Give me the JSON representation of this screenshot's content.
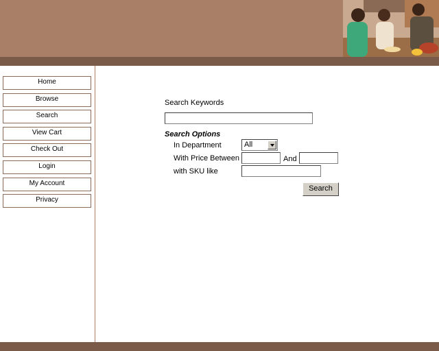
{
  "nav": {
    "items": [
      "Home",
      "Browse",
      "Search",
      "View Cart",
      "Check Out",
      "Login",
      "My Account",
      "Privacy"
    ]
  },
  "search": {
    "keywords_label": "Search Keywords",
    "keywords_value": "",
    "options_heading": "Search Options",
    "department_label": "In Department",
    "department_value": "All",
    "price_label": "With Price Between",
    "price_min": "",
    "price_and": "And",
    "price_max": "",
    "sku_label": "with SKU like",
    "sku_value": "",
    "submit_label": "Search"
  },
  "colors": {
    "header": "#a97f67",
    "band": "#7a5a48"
  }
}
